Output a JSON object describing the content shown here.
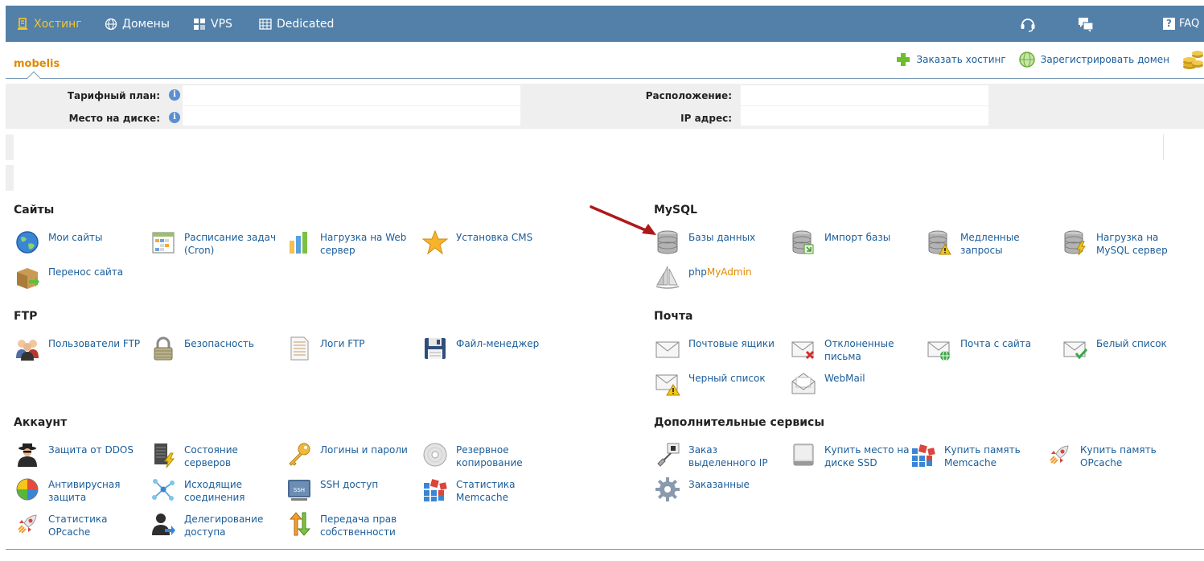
{
  "nav": {
    "items": [
      {
        "label": "Хостинг",
        "icon": "server-icon",
        "active": true
      },
      {
        "label": "Домены",
        "icon": "globe-icon"
      },
      {
        "label": "VPS",
        "icon": "vps-icon"
      },
      {
        "label": "Dedicated",
        "icon": "dedicated-icon"
      }
    ],
    "faq_label": "FAQ"
  },
  "account": {
    "name": "mobelis",
    "order_hosting": "Заказать хостинг",
    "register_domain": "Зарегистрировать домен"
  },
  "info": {
    "tariff_label": "Тарифный план:",
    "disk_label": "Место на диске:",
    "location_label": "Расположение:",
    "ip_label": "IP адрес:"
  },
  "sections": {
    "sites": {
      "title": "Сайты",
      "items": [
        "Мои сайты",
        "Расписание задач (Cron)",
        "Нагрузка на Web сервер",
        "Установка CMS",
        "Перенос сайта"
      ]
    },
    "mysql": {
      "title": "MySQL",
      "items": [
        "Базы данных",
        "Импорт базы",
        "Медленные запросы",
        "Нагрузка на MySQL сервер"
      ],
      "pma_php": "php",
      "pma_my": "MyAdmin"
    },
    "ftp": {
      "title": "FTP",
      "items": [
        "Пользователи FTP",
        "Безопасность",
        "Логи FTP",
        "Файл-менеджер"
      ]
    },
    "mail": {
      "title": "Почта",
      "items": [
        "Почтовые ящики",
        "Отклоненные письма",
        "Почта с сайта",
        "Белый список",
        "Черный список",
        "WebMail"
      ]
    },
    "account": {
      "title": "Аккаунт",
      "items": [
        "Защита от DDOS",
        "Состояние серверов",
        "Логины и пароли",
        "Резервное копирование",
        "Антивирусная защита",
        "Исходящие соединения",
        "SSH доступ",
        "Статистика Memcache",
        "Статистика OPcache",
        "Делегирование доступа",
        "Передача прав собственности"
      ]
    },
    "extra": {
      "title": "Дополнительные сервисы",
      "items": [
        "Заказ выделенного IP",
        "Купить место на диске SSD",
        "Купить память Memcache",
        "Купить память OPcache",
        "Заказанные"
      ]
    }
  },
  "colors": {
    "nav_bg": "#5280a8",
    "active": "#f4c430",
    "link": "#1a5d99",
    "accent": "#e08a00",
    "annotation_arrow": "#b01818"
  }
}
